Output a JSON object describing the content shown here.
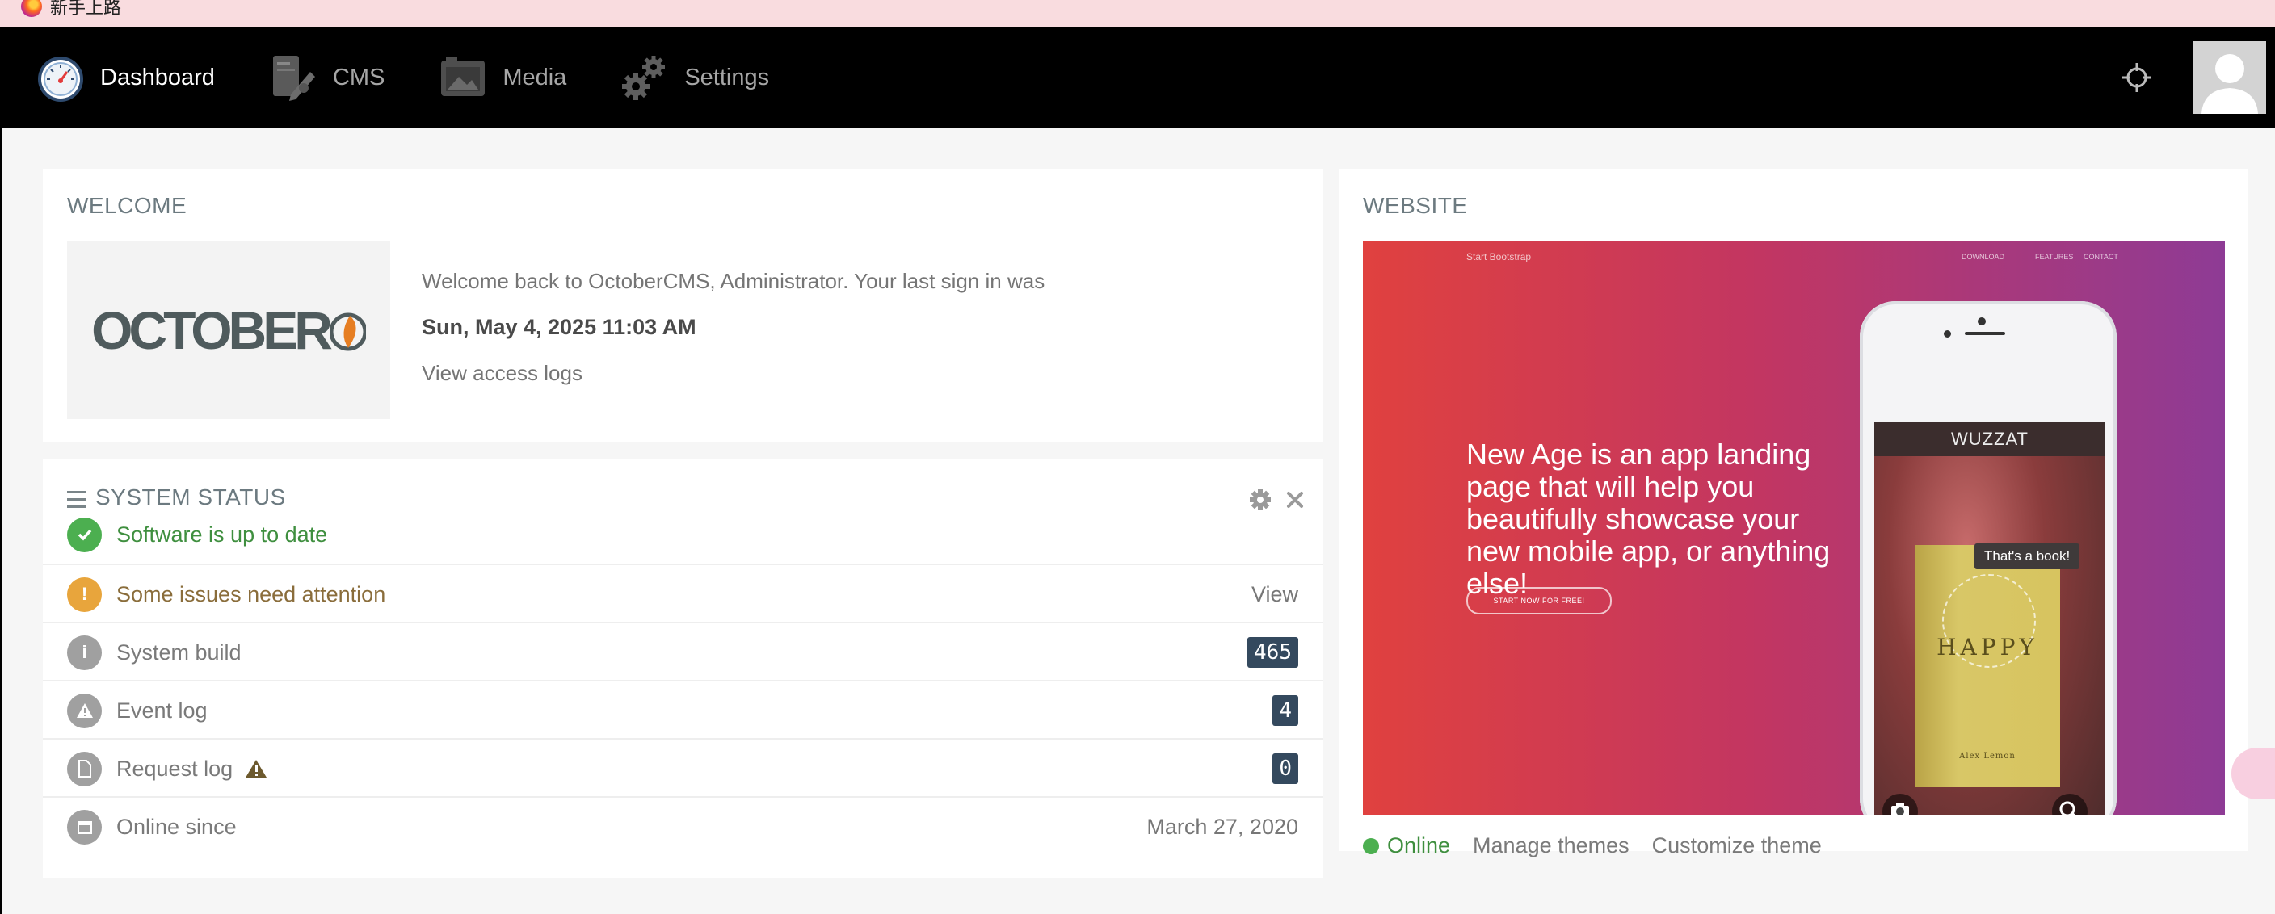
{
  "browser": {
    "bookmark_label": "新手上路",
    "icon": "firefox-icon"
  },
  "nav": {
    "items": [
      {
        "label": "Dashboard",
        "icon": "speedometer-icon",
        "active": true
      },
      {
        "label": "CMS",
        "icon": "cms-icon",
        "active": false
      },
      {
        "label": "Media",
        "icon": "media-icon",
        "active": false
      },
      {
        "label": "Settings",
        "icon": "gears-icon",
        "active": false
      }
    ],
    "right_icons": [
      "crosshair-icon",
      "avatar"
    ]
  },
  "welcome": {
    "title": "WELCOME",
    "logo_text": "OCTOBER",
    "message": "Welcome back to OctoberCMS, Administrator. Your last sign in was",
    "last_sign_in": "Sun, May 4, 2025 11:03 AM",
    "access_logs_link": "View access logs"
  },
  "system_status": {
    "title": "SYSTEM STATUS",
    "rows": [
      {
        "label": "Software is up to date",
        "status": "success",
        "right": ""
      },
      {
        "label": "Some issues need attention",
        "status": "warning",
        "right": "View"
      },
      {
        "label": "System build",
        "status": "info",
        "badge": "465"
      },
      {
        "label": "Event log",
        "status": "alert",
        "badge": "4"
      },
      {
        "label": "Request log",
        "status": "file",
        "badge": "0"
      },
      {
        "label": "Online since",
        "status": "calendar",
        "right": "March 27, 2020"
      }
    ]
  },
  "website": {
    "title": "WEBSITE",
    "preview": {
      "brand": "Start Bootstrap",
      "menu": [
        "DOWNLOAD",
        "FEATURES",
        "CONTACT"
      ],
      "headline": "New Age is an app landing page that will help you beautifully showcase your new mobile app, or anything else!",
      "button": "START NOW FOR FREE!",
      "app_title": "WUZZAT",
      "tooltip": "That's a book!",
      "book_title": "HAPPY",
      "book_author": "Alex Lemon"
    },
    "status": "Online",
    "links": [
      "Manage themes",
      "Customize theme"
    ]
  },
  "colors": {
    "nav_bg": "#000000",
    "success": "#4caf50",
    "warning": "#e8a53c",
    "muted": "#9e9e9e",
    "badge": "#34495e",
    "accent_orange": "#e67e22"
  }
}
